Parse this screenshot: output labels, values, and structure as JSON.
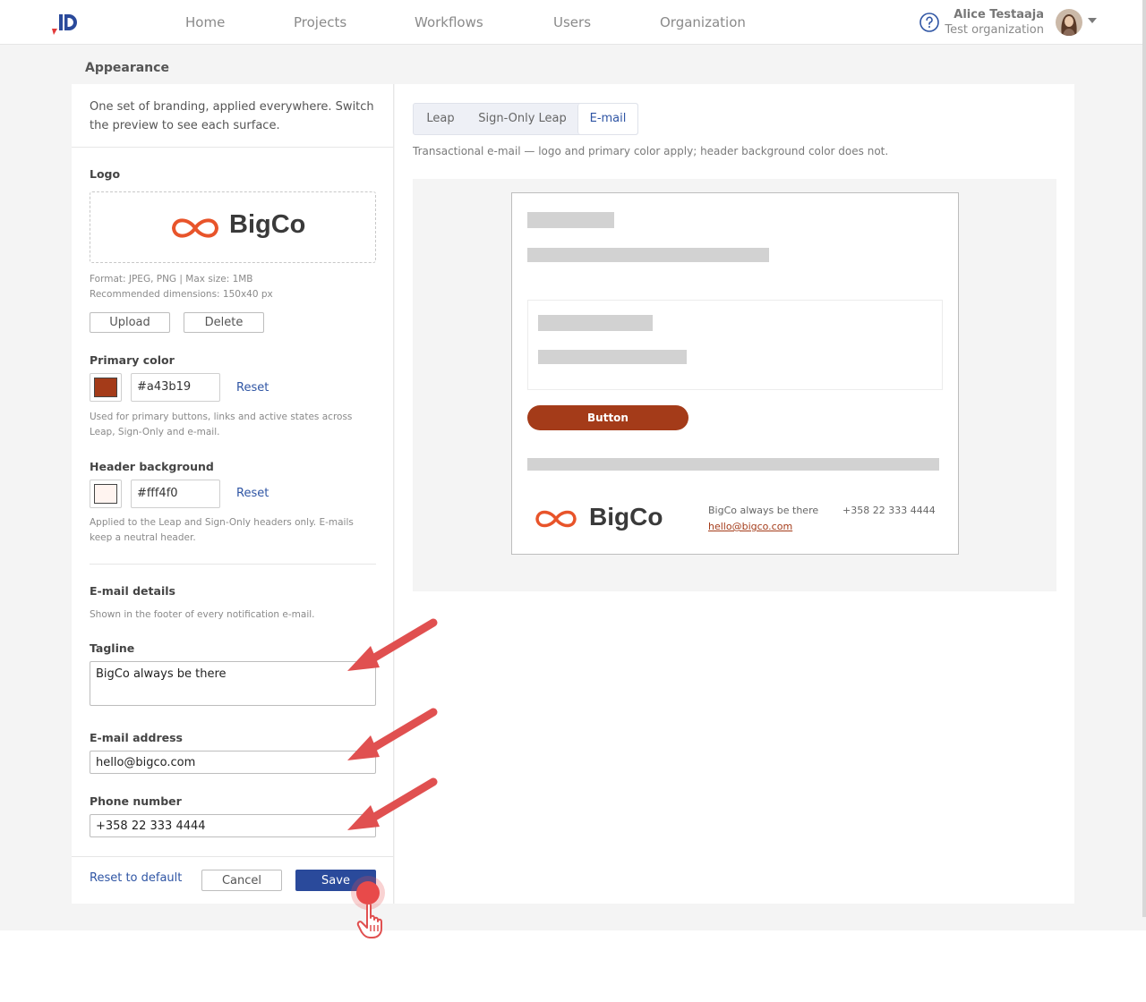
{
  "nav": {
    "items": [
      "Home",
      "Projects",
      "Workflows",
      "Users",
      "Organization"
    ],
    "user_name": "Alice Testaaja",
    "user_org": "Test organization"
  },
  "page": {
    "title": "Appearance"
  },
  "left": {
    "intro": "One set of branding, applied everywhere. Switch the preview to see each surface.",
    "logo_label": "Logo",
    "logo_brand": "BigCo",
    "logo_format": "Format: JPEG, PNG | Max size: 1MB",
    "logo_dims": "Recommended dimensions: 150x40 px",
    "upload_label": "Upload",
    "delete_label": "Delete",
    "primary_label": "Primary color",
    "primary_value": "#a43b19",
    "primary_reset": "Reset",
    "primary_help": "Used for primary buttons, links and active states across Leap, Sign-Only and e-mail.",
    "header_label": "Header background",
    "header_value": "#fff4f0",
    "header_reset": "Reset",
    "header_help": "Applied to the Leap and Sign-Only headers only. E-mails keep a neutral header.",
    "email_details_label": "E-mail details",
    "email_details_help": "Shown in the footer of every notification e-mail.",
    "tagline_label": "Tagline",
    "tagline_value": "BigCo always be there",
    "email_label": "E-mail address",
    "email_value": "hello@bigco.com",
    "phone_label": "Phone number",
    "phone_value": "+358 22 333 4444",
    "reset_default": "Reset to default",
    "cancel_label": "Cancel",
    "save_label": "Save"
  },
  "right": {
    "tabs": [
      "Leap",
      "Sign-Only Leap",
      "E-mail"
    ],
    "active_tab": "E-mail",
    "preview_desc": "Transactional e-mail — logo and primary color apply; header background color does not.",
    "email_button": "Button",
    "footer_brand": "BigCo",
    "footer_tagline": "BigCo always be there",
    "footer_email": "hello@bigco.com",
    "footer_phone": "+358 22 333 4444"
  },
  "colors": {
    "primary": "#a43b19",
    "header_bg": "#fff4f0",
    "nav_accent": "#2a4a9b",
    "logo_orange": "#e8542a"
  },
  "icons": [
    "app-logo-icon",
    "help-icon",
    "avatar",
    "chevron-down-icon",
    "infinity-logo-icon",
    "annotation-arrow",
    "cursor-hand-icon"
  ]
}
